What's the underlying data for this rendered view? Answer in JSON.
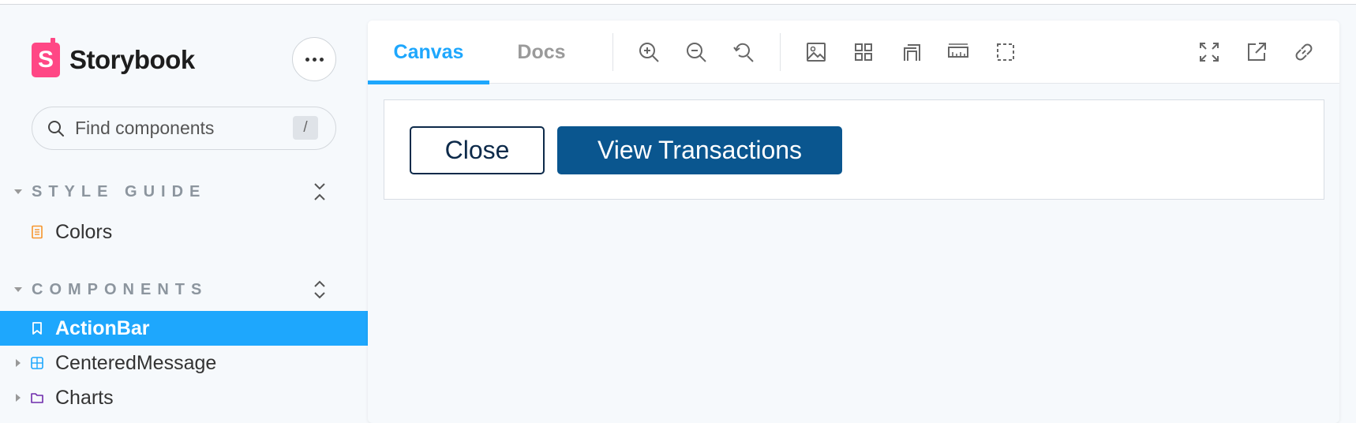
{
  "app": {
    "brand_initial": "S",
    "brand_name": "Storybook",
    "accent_color": "#1ea7fd",
    "brand_color": "#ff4785"
  },
  "sidebar": {
    "menu_icon": "ellipsis-icon",
    "search": {
      "placeholder": "Find components",
      "shortcut": "/"
    },
    "sections": [
      {
        "title": "STYLE GUIDE",
        "toggle_icon": "collapse-icon",
        "items": [
          {
            "label": "Colors",
            "icon": "document-icon"
          }
        ]
      },
      {
        "title": "COMPONENTS",
        "toggle_icon": "expand-icon",
        "items": [
          {
            "label": "ActionBar",
            "icon": "bookmark-icon",
            "active": true
          },
          {
            "label": "CenteredMessage",
            "icon": "component-icon"
          },
          {
            "label": "Charts",
            "icon": "folder-icon"
          }
        ]
      }
    ]
  },
  "toolbar": {
    "tabs": [
      {
        "label": "Canvas",
        "active": true
      },
      {
        "label": "Docs"
      }
    ],
    "tools": [
      "zoom-in-icon",
      "zoom-out-icon",
      "zoom-reset-icon",
      "background-icon",
      "grid-icon",
      "viewport-icon",
      "measure-icon",
      "outline-icon"
    ],
    "right_tools": [
      "fullscreen-icon",
      "open-new-tab-icon",
      "copy-link-icon"
    ]
  },
  "preview": {
    "close_label": "Close",
    "view_label": "View Transactions"
  }
}
